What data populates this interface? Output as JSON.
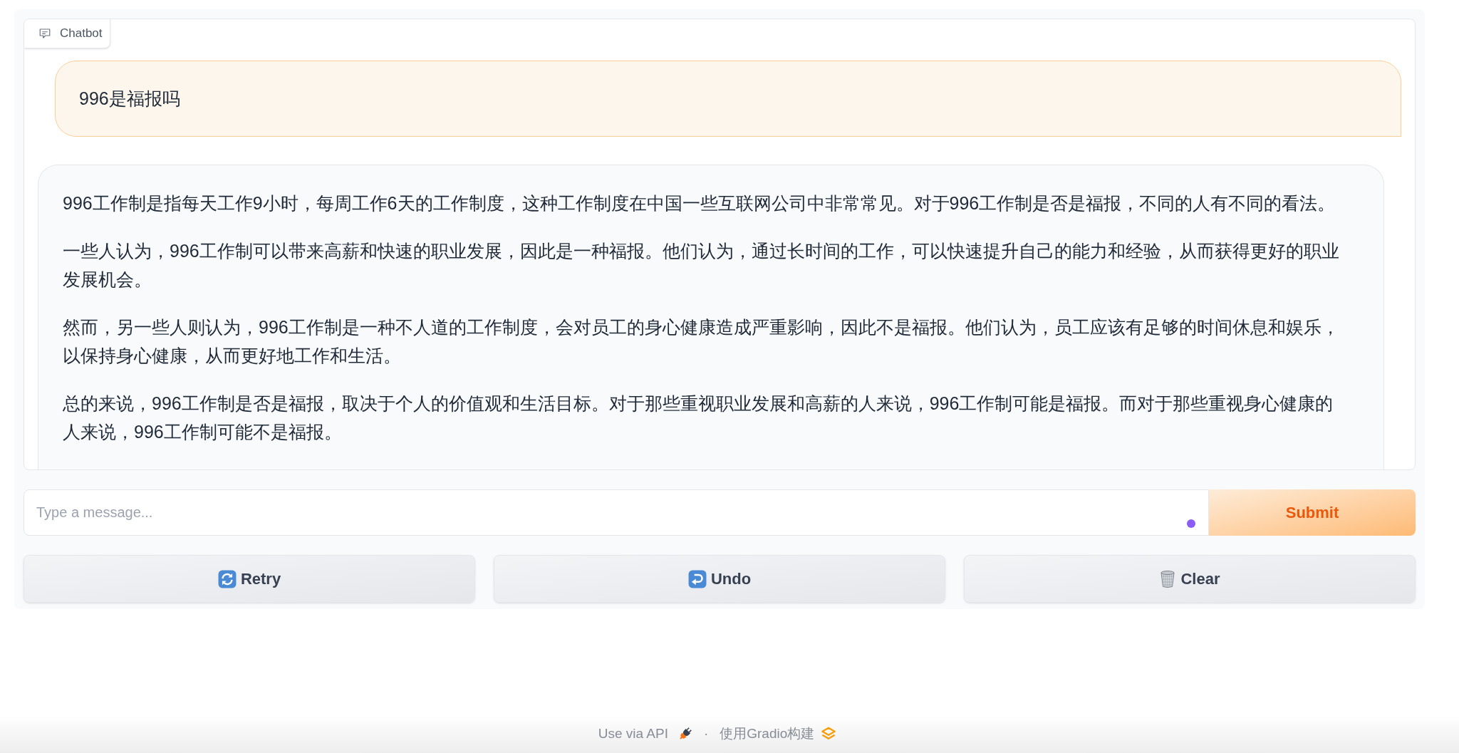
{
  "chatbot": {
    "label": "Chatbot",
    "messages": [
      {
        "kind": "user",
        "paragraphs": [
          "996是福报吗"
        ]
      },
      {
        "kind": "bot",
        "paragraphs": [
          "996工作制是指每天工作9小时，每周工作6天的工作制度，这种工作制度在中国一些互联网公司中非常常见。对于996工作制是否是福报，不同的人有不同的看法。",
          "一些人认为，996工作制可以带来高薪和快速的职业发展，因此是一种福报。他们认为，通过长时间的工作，可以快速提升自己的能力和经验，从而获得更好的职业发展机会。",
          "然而，另一些人则认为，996工作制是一种不人道的工作制度，会对员工的身心健康造成严重影响，因此不是福报。他们认为，员工应该有足够的时间休息和娱乐，以保持身心健康，从而更好地工作和生活。",
          "总的来说，996工作制是否是福报，取决于个人的价值观和生活目标。对于那些重视职业发展和高薪的人来说，996工作制可能是福报。而对于那些重视身心健康的人来说，996工作制可能不是福报。"
        ]
      }
    ]
  },
  "composer": {
    "placeholder": "Type a message...",
    "submit": "Submit"
  },
  "actions": [
    {
      "kind": "retry",
      "label": "Retry"
    },
    {
      "kind": "undo",
      "label": "Undo"
    },
    {
      "kind": "clear",
      "label": "Clear"
    }
  ],
  "footer": {
    "api_link": "Use via API",
    "separator": "·",
    "built_with": "使用Gradio构建"
  }
}
